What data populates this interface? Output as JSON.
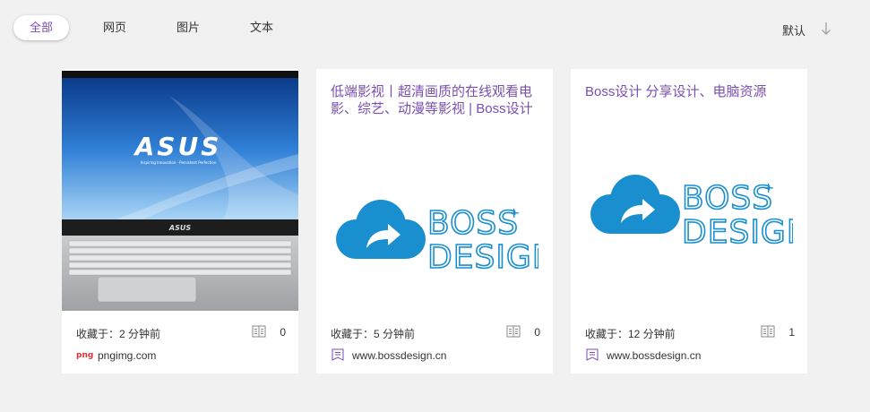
{
  "tabs": [
    {
      "label": "全部",
      "active": true
    },
    {
      "label": "网页",
      "active": false
    },
    {
      "label": "图片",
      "active": false
    },
    {
      "label": "文本",
      "active": false
    }
  ],
  "sort": {
    "label": "默认",
    "icon": "arrow-down-icon"
  },
  "colors": {
    "accent": "#7a4fb0",
    "logo_blue": "#1a8fd0",
    "background": "#f1f1f1"
  },
  "cards": [
    {
      "title": "",
      "image": "asus-laptop-image",
      "saved": "收藏于：2 分钟前",
      "count": "0",
      "source_badge": "png",
      "source": "pngimg.com"
    },
    {
      "title": "低端影视丨超清画质的在线观看电影、综艺、动漫等影视 | Boss设计",
      "image": "boss-design-logo",
      "saved": "收藏于：5 分钟前",
      "count": "0",
      "source": "www.bossdesign.cn"
    },
    {
      "title": "Boss设计 分享设计、电脑资源",
      "image": "boss-design-logo",
      "saved": "收藏于：12 分钟前",
      "count": "1",
      "source": "www.bossdesign.cn"
    }
  ],
  "logo": {
    "line1": "BOSS",
    "plus": "+",
    "line2": "DESIGN"
  },
  "asus": {
    "brand": "ASUS",
    "tagline": "Inspiring Innovation · Persistent Perfection"
  }
}
